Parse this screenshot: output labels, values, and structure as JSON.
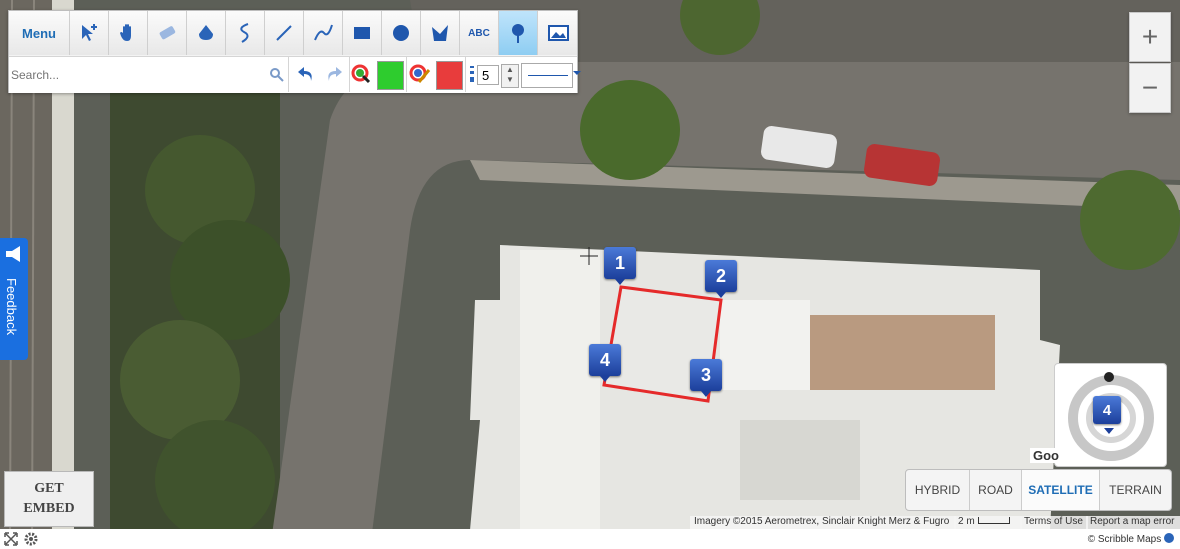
{
  "toolbar": {
    "menu_label": "Menu",
    "tools": [
      {
        "name": "move-tool",
        "icon": "move-arrows-icon"
      },
      {
        "name": "pan-tool",
        "icon": "hand-icon"
      },
      {
        "name": "eraser-tool",
        "icon": "eraser-icon"
      },
      {
        "name": "fill-tool",
        "icon": "paint-bucket-icon"
      },
      {
        "name": "freehand-tool",
        "icon": "curve-icon"
      },
      {
        "name": "line-tool",
        "icon": "line-icon"
      },
      {
        "name": "route-tool",
        "icon": "route-icon"
      },
      {
        "name": "rectangle-tool",
        "icon": "rectangle-icon"
      },
      {
        "name": "circle-tool",
        "icon": "circle-icon"
      },
      {
        "name": "polygon-tool",
        "icon": "polygon-icon"
      },
      {
        "name": "text-tool",
        "icon": "abc-icon",
        "label": "ABC"
      },
      {
        "name": "marker-tool",
        "icon": "pin-icon",
        "active": true
      },
      {
        "name": "image-tool",
        "icon": "image-icon"
      }
    ],
    "search_placeholder": "Search...",
    "line_width": "5",
    "fill_color": "#2ecc2e",
    "line_color": "#e83c3c"
  },
  "markers": [
    "1",
    "2",
    "3",
    "4"
  ],
  "marker_count": "4",
  "map_types": [
    {
      "label": "HYBRID",
      "active": false
    },
    {
      "label": "ROAD",
      "active": false
    },
    {
      "label": "SATELLITE",
      "active": true
    },
    {
      "label": "TERRAIN",
      "active": false
    }
  ],
  "feedback_label": "Feedback",
  "get_embed_label": "GET EMBED",
  "google_label": "Goo",
  "attribution": "Imagery ©2015 Aerometrex, Sinclair Knight Merz & Fugro",
  "scale_label": "2 m",
  "terms_label": "Terms of Use",
  "report_label": "Report a map error",
  "credit_label": "© Scribble Maps",
  "zoom_in": "+",
  "zoom_out": "−"
}
